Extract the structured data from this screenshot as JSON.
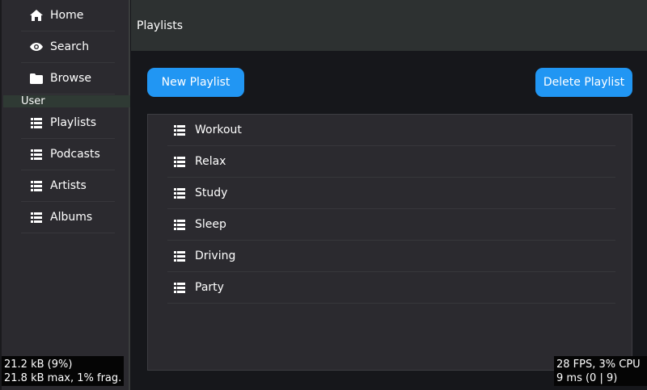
{
  "header": {
    "title": "Playlists"
  },
  "sidebar": {
    "items": [
      {
        "label": "Home",
        "icon": "home-icon"
      },
      {
        "label": "Search",
        "icon": "eye-icon"
      },
      {
        "label": "Browse",
        "icon": "folder-icon"
      }
    ],
    "section_label": "User",
    "user_items": [
      {
        "label": "Playlists",
        "icon": "list-icon"
      },
      {
        "label": "Podcasts",
        "icon": "list-icon"
      },
      {
        "label": "Artists",
        "icon": "list-icon"
      },
      {
        "label": "Albums",
        "icon": "list-icon"
      }
    ]
  },
  "toolbar": {
    "new_label": "New Playlist",
    "delete_label": "Delete Playlist"
  },
  "playlists": [
    {
      "label": "Workout"
    },
    {
      "label": "Relax"
    },
    {
      "label": "Study"
    },
    {
      "label": "Sleep"
    },
    {
      "label": "Driving"
    },
    {
      "label": "Party"
    }
  ],
  "overlays": {
    "mem_line1": "21.2 kB (9%)",
    "mem_line2": "21.8 kB max, 1% frag.",
    "perf_line1": "28 FPS, 3% CPU",
    "perf_line2": "9 ms (0 | 9)"
  },
  "colors": {
    "accent": "#2196f3",
    "sidebar_bg": "#2b2a2f",
    "header_bg": "#2d3131",
    "content_bg": "#16171b"
  }
}
